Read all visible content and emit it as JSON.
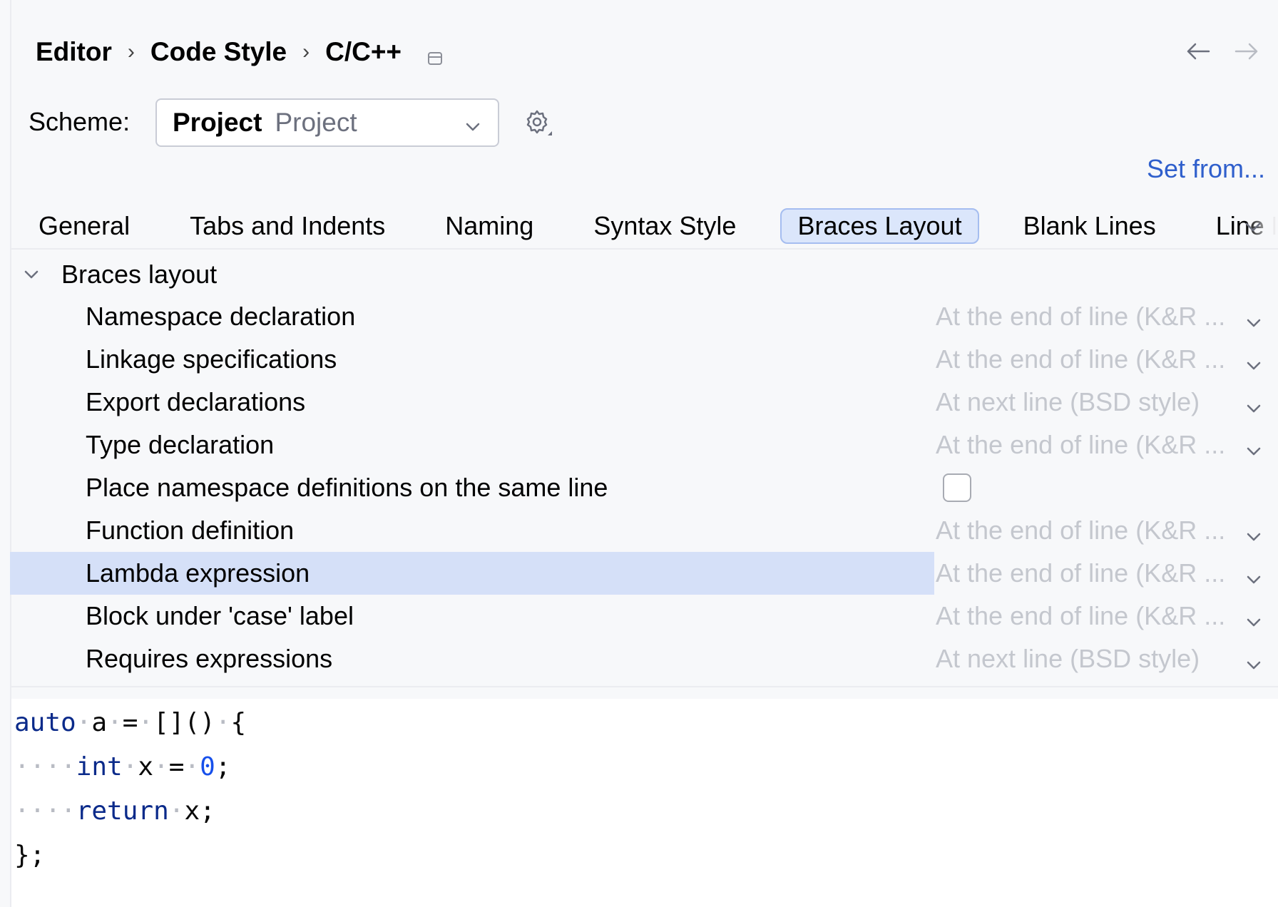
{
  "breadcrumb": {
    "items": [
      "Editor",
      "Code Style",
      "C/C++"
    ],
    "separator": "›"
  },
  "scheme": {
    "label": "Scheme:",
    "name": "Project",
    "sub": "Project"
  },
  "set_from": "Set from...",
  "tabs": [
    {
      "label": "General"
    },
    {
      "label": "Tabs and Indents"
    },
    {
      "label": "Naming"
    },
    {
      "label": "Syntax Style"
    },
    {
      "label": "Braces Layout",
      "active": true
    },
    {
      "label": "Blank Lines"
    },
    {
      "label": "Line Breaks"
    }
  ],
  "tree": {
    "group_label": "Braces layout",
    "rows": [
      {
        "label": "Namespace declaration",
        "value": "At the end of line (K&R ..."
      },
      {
        "label": "Linkage specifications",
        "value": "At the end of line (K&R ..."
      },
      {
        "label": "Export declarations",
        "value": "At next line (BSD style)"
      },
      {
        "label": "Type declaration",
        "value": "At the end of line (K&R ..."
      },
      {
        "label": "Place namespace definitions on the same line",
        "checkbox": false
      },
      {
        "label": "Function definition",
        "value": "At the end of line (K&R ..."
      },
      {
        "label": "Lambda expression",
        "value": "At the end of line (K&R ...",
        "selected": true
      },
      {
        "label": "Block under 'case' label",
        "value": "At the end of line (K&R ..."
      },
      {
        "label": "Requires expressions",
        "value": "At next line (BSD style)"
      }
    ]
  },
  "code_preview": {
    "lines": [
      [
        {
          "t": "auto",
          "c": "kw"
        },
        {
          "t": "·",
          "c": "ws"
        },
        {
          "t": "a"
        },
        {
          "t": "·",
          "c": "ws"
        },
        {
          "t": "="
        },
        {
          "t": "·",
          "c": "ws"
        },
        {
          "t": "[]()"
        },
        {
          "t": "·",
          "c": "ws"
        },
        {
          "t": "{"
        }
      ],
      [
        {
          "t": "····",
          "c": "ws"
        },
        {
          "t": "int",
          "c": "kw"
        },
        {
          "t": "·",
          "c": "ws"
        },
        {
          "t": "x"
        },
        {
          "t": "·",
          "c": "ws"
        },
        {
          "t": "="
        },
        {
          "t": "·",
          "c": "ws"
        },
        {
          "t": "0",
          "c": "num"
        },
        {
          "t": ";"
        }
      ],
      [
        {
          "t": "····",
          "c": "ws"
        },
        {
          "t": "return",
          "c": "kw"
        },
        {
          "t": "·",
          "c": "ws"
        },
        {
          "t": "x;"
        }
      ],
      [
        {
          "t": "};"
        }
      ]
    ]
  },
  "colors": {
    "accent_link": "#2f5fcc",
    "selection": "#d5e0f8",
    "active_tab": "#dbe6fb",
    "keyword": "#0a2a8a",
    "number": "#1750eb",
    "disabled_text": "#c4c7ce"
  },
  "icons": {
    "window": "window-icon",
    "back": "arrow-left-icon",
    "forward": "arrow-right-icon",
    "gear": "gear-icon",
    "chevron": "chevron-down-icon"
  }
}
